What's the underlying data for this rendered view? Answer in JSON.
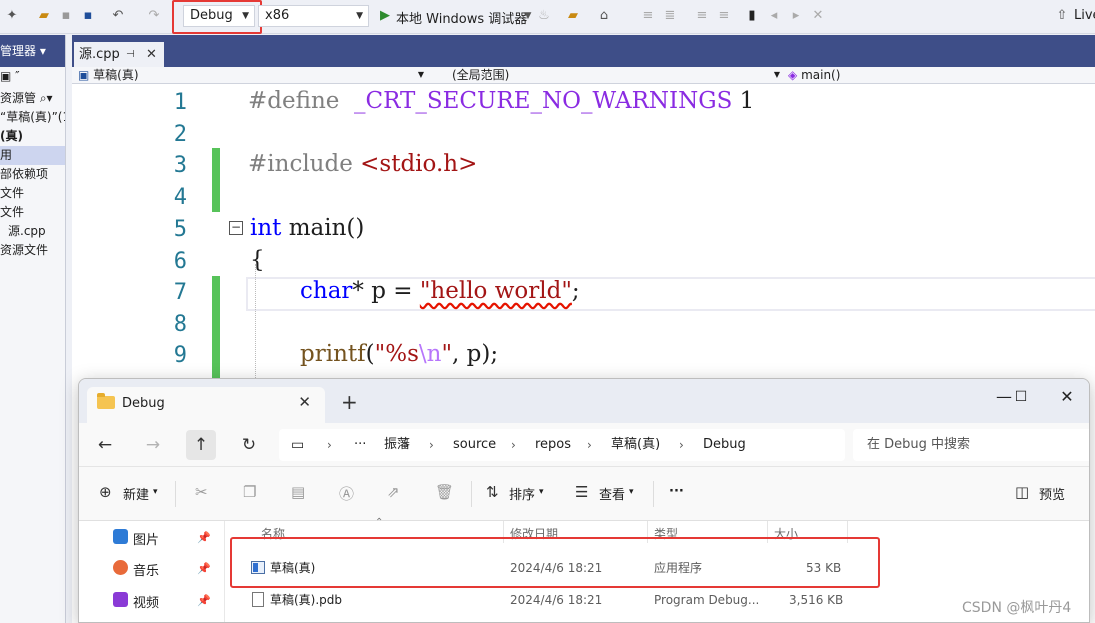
{
  "toolbar": {
    "config": "Debug",
    "platform": "x86",
    "run_label": "本地 Windows 调试器",
    "live_label": "Live"
  },
  "solution_explorer": {
    "title": "管理器",
    "search_label": "资源管",
    "rows": [
      "“草稿(真)”(1",
      "(真)",
      "用",
      "部依赖项",
      "文件",
      "文件",
      "源.cpp",
      "资源文件"
    ]
  },
  "editor": {
    "tab_name": "源.cpp",
    "nav": {
      "project": "草稿(真)",
      "scope": "(全局范围)",
      "member": "main()"
    },
    "line_numbers": [
      "1",
      "2",
      "3",
      "4",
      "5",
      "6",
      "7",
      "8",
      "9"
    ],
    "code": {
      "l1_pp": "#define",
      "l1_macro": "_CRT_SECURE_NO_WARNINGS",
      "l1_num": "1",
      "l3_pp": "#include",
      "l3_hdr": "<stdio.h>",
      "l5_kw": "int",
      "l5_rest": "main()",
      "l6": "{",
      "l7_kw": "char",
      "l7_mid": "* p =",
      "l7_str": "\"hello world\"",
      "l7_end": ";",
      "l9_fn": "printf",
      "l9_open": "(",
      "l9_str1": "\"%s",
      "l9_esc": "\\n",
      "l9_str2": "\"",
      "l9_end": ", p);"
    }
  },
  "file_explorer": {
    "tab_title": "Debug",
    "breadcrumbs": [
      "振藩",
      "source",
      "repos",
      "草稿(真)",
      "Debug"
    ],
    "search_placeholder": "在 Debug 中搜索",
    "commands": {
      "new": "新建",
      "sort": "排序",
      "view": "查看",
      "more": "···",
      "preview": "预览"
    },
    "sidebar": [
      "图片",
      "音乐",
      "视频"
    ],
    "columns": [
      "名称",
      "修改日期",
      "类型",
      "大小"
    ],
    "files": [
      {
        "name": "草稿(真)",
        "date": "2024/4/6 18:21",
        "type": "应用程序",
        "size": "53 KB"
      },
      {
        "name": "草稿(真).pdb",
        "date": "2024/4/6 18:21",
        "type": "Program Debug...",
        "size": "3,516 KB"
      }
    ]
  },
  "watermark": "CSDN @枫叶丹4",
  "colors": {
    "highlight_red": "#e53935",
    "vs_title_blue": "#3e4e88",
    "change_green": "#57c35a"
  }
}
